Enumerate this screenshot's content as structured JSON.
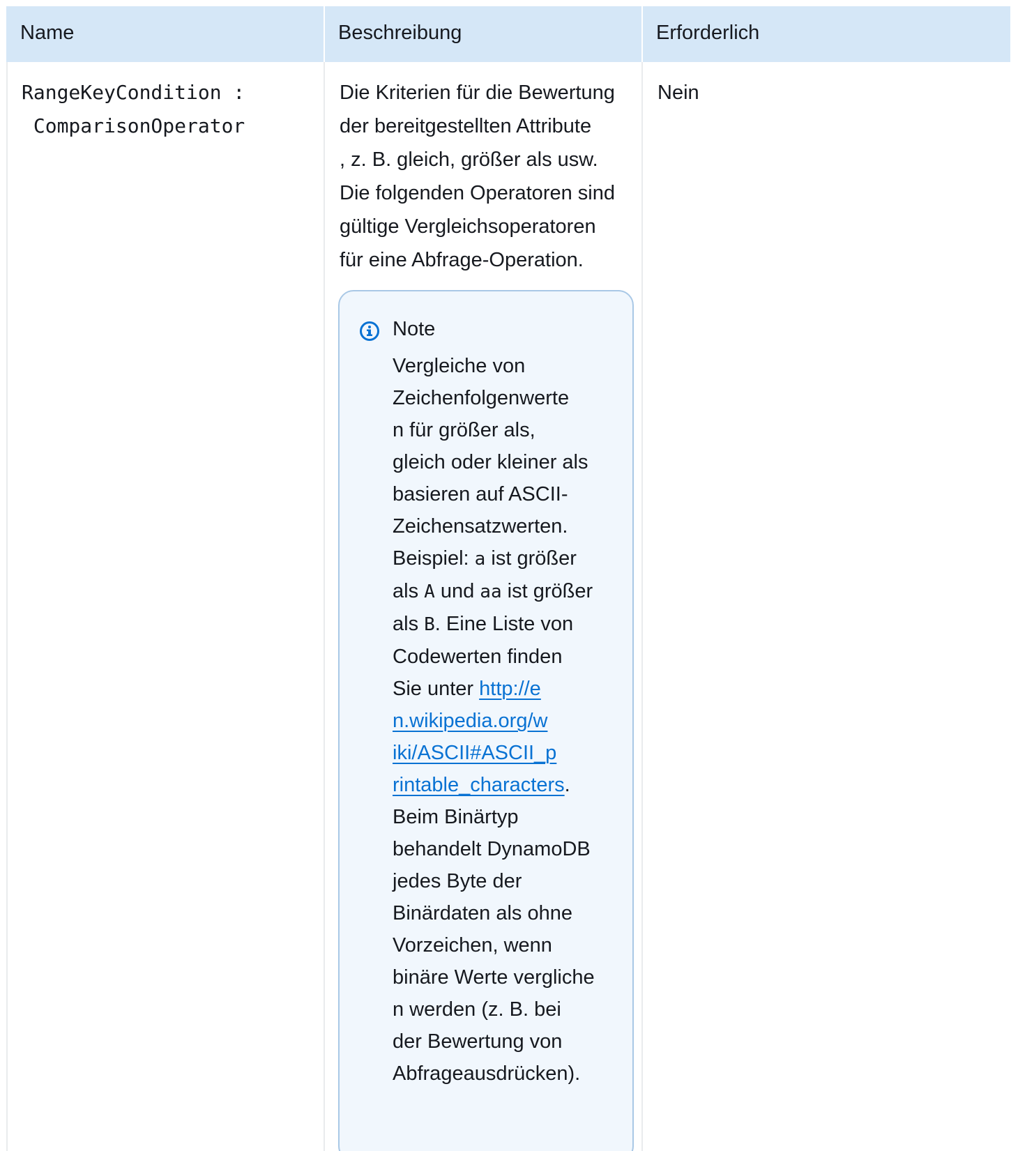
{
  "table": {
    "headers": {
      "name": "Name",
      "description": "Beschreibung",
      "required": "Erforderlich"
    },
    "row": {
      "name_line1": "RangeKeyCondition :",
      "name_line2": " ComparisonOperator",
      "description_lines": [
        "Die Kriterien für die Bewertung",
        "der bereitgestellten Attribute",
        ", z. B. gleich, größer als usw.",
        "Die folgenden Operatoren sind",
        "gültige Vergleichsoperatoren",
        "für eine Abfrage-Operation."
      ],
      "required": "Nein"
    },
    "note": {
      "icon": "info-icon",
      "title": "Note",
      "lines_before_code": [
        "Vergleiche von",
        "Zeichenfolgenwerte",
        "n für größer als,",
        "gleich oder kleiner als",
        "basieren auf ASCII-",
        "Zeichensatzwerten."
      ],
      "example_prefix": "Beispiel: ",
      "code_a": "a",
      "example_mid": " ist größer",
      "als_word": "als ",
      "code_A": "A",
      "und_text": " und ",
      "code_aa": "aa",
      "ist_groesser": " ist größer",
      "code_B": "B",
      "liste_text": ". Eine Liste von",
      "codewerten": "Codewerten finden",
      "sie_unter": "Sie unter ",
      "link_lines": [
        "http://e",
        "n.wikipedia.org/w",
        "iki/ASCII#ASCII_p",
        "rintable_characters"
      ],
      "after_link": ".",
      "lines_after": [
        "Beim Binärtyp",
        "behandelt DynamoDB",
        "jedes Byte der",
        "Binärdaten als ohne",
        "Vorzeichen, wenn",
        "binäre Werte vergliche",
        "n werden (z. B. bei",
        "der Bewertung von",
        "Abfrageausdrücken)."
      ]
    }
  },
  "colors": {
    "header_bg": "#d5e7f7",
    "note_border": "#a9c8e6",
    "note_bg": "#f1f7fd",
    "link": "#0972d3",
    "icon": "#0972d3"
  }
}
